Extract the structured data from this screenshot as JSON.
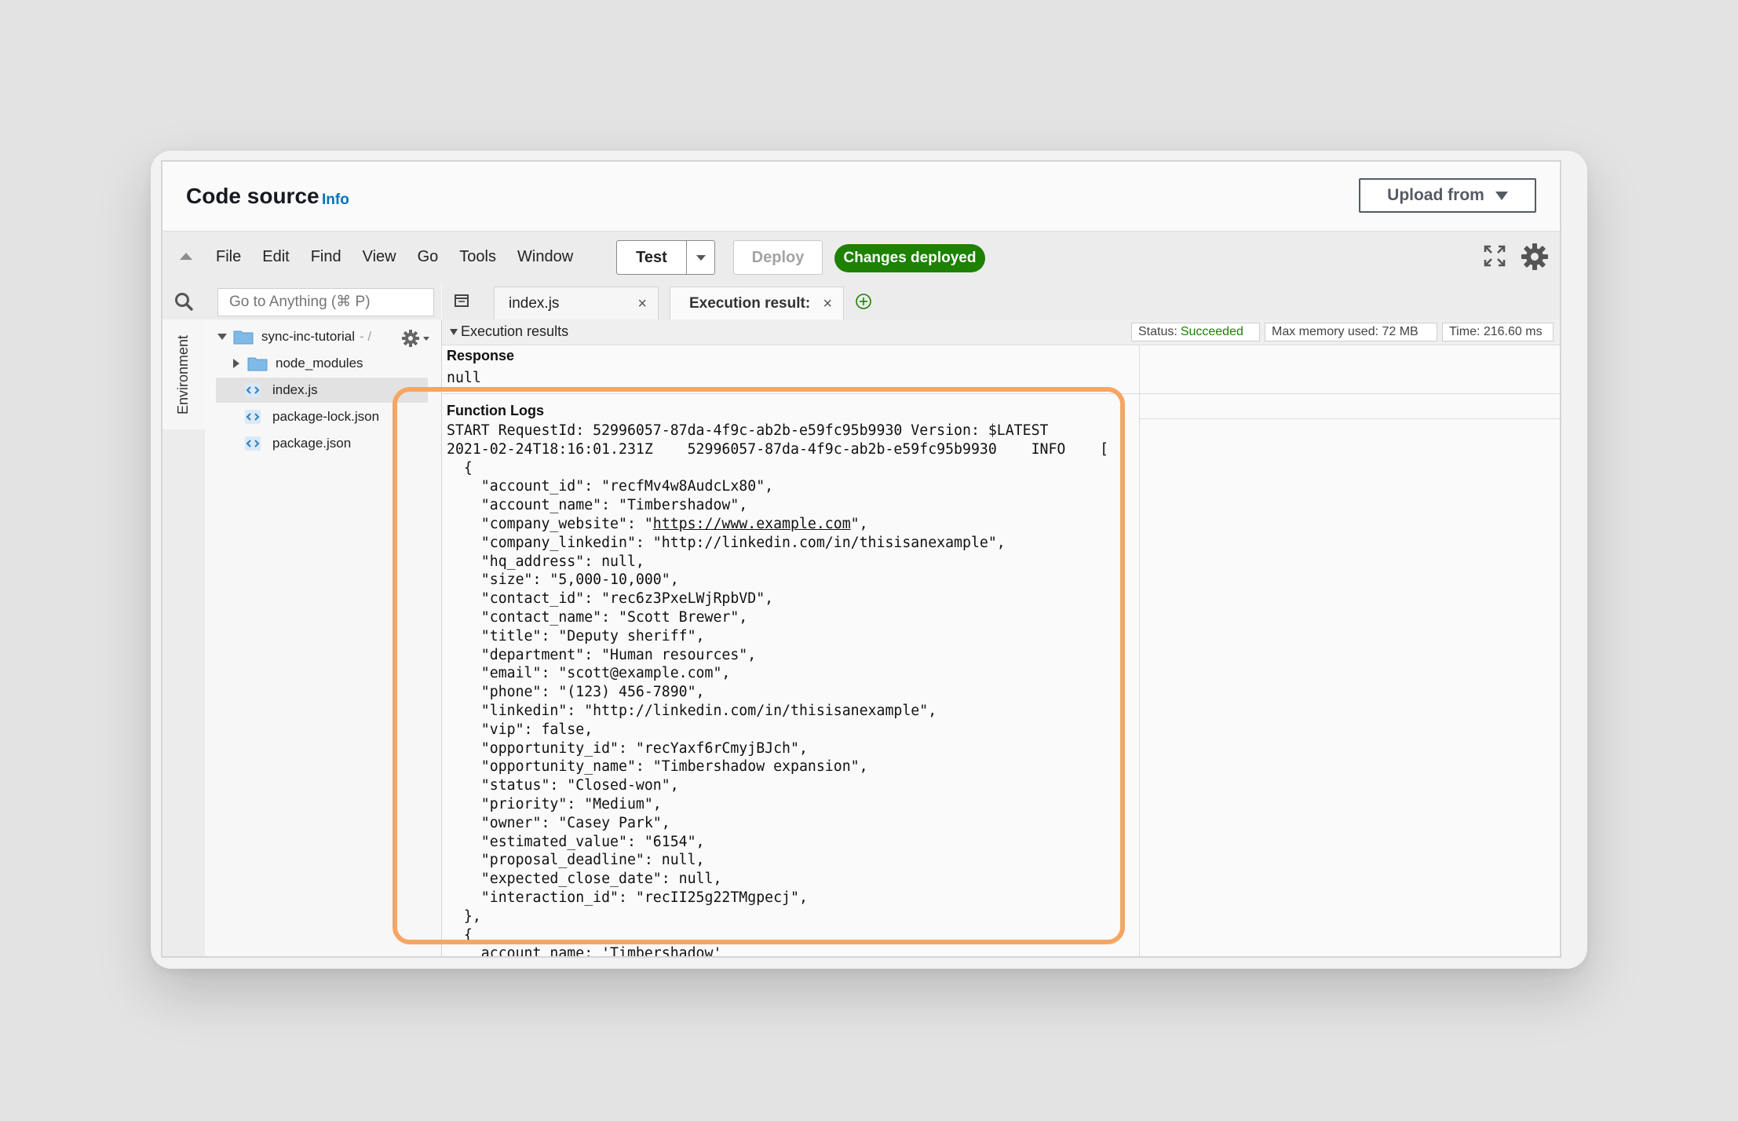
{
  "header": {
    "title": "Code source",
    "info_label": "Info",
    "upload_label": "Upload from"
  },
  "toolbar": {
    "menu": [
      "File",
      "Edit",
      "Find",
      "View",
      "Go",
      "Tools",
      "Window"
    ],
    "test_label": "Test",
    "deploy_label": "Deploy",
    "status_badge": "Changes deployed"
  },
  "sidebar": {
    "search_placeholder": "Go to Anything (⌘ P)",
    "env_label": "Environment",
    "root_folder": "sync-inc-tutorial",
    "root_suffix": "- /",
    "items": [
      {
        "label": "node_modules",
        "type": "folder"
      },
      {
        "label": "index.js",
        "type": "file",
        "selected": true
      },
      {
        "label": "package-lock.json",
        "type": "file"
      },
      {
        "label": "package.json",
        "type": "file"
      }
    ]
  },
  "tabs": [
    {
      "label": "index.js"
    },
    {
      "label": "Execution result:"
    }
  ],
  "results": {
    "heading": "Execution results",
    "status_label": "Status:",
    "status_value": "Succeeded",
    "memory": "Max memory used: 72 MB",
    "time": "Time: 216.60 ms",
    "response_label": "Response",
    "response_value": "null",
    "logs_label": "Function Logs",
    "log_lines": [
      "START RequestId: 52996057-87da-4f9c-ab2b-e59fc95b9930 Version: $LATEST",
      "2021-02-24T18:16:01.231Z    52996057-87da-4f9c-ab2b-e59fc95b9930    INFO    [",
      "  {",
      "    \"account_id\": \"recfMv4w8AudcLx80\",",
      "    \"account_name\": \"Timbershadow\",",
      "    \"company_website\": \"https://www.example.com\",",
      "    \"company_linkedin\": \"http://linkedin.com/in/thisisanexample\",",
      "    \"hq_address\": null,",
      "    \"size\": \"5,000-10,000\",",
      "    \"contact_id\": \"rec6z3PxeLWjRpbVD\",",
      "    \"contact_name\": \"Scott Brewer\",",
      "    \"title\": \"Deputy sheriff\",",
      "    \"department\": \"Human resources\",",
      "    \"email\": \"scott@example.com\",",
      "    \"phone\": \"(123) 456-7890\",",
      "    \"linkedin\": \"http://linkedin.com/in/thisisanexample\",",
      "    \"vip\": false,",
      "    \"opportunity_id\": \"recYaxf6rCmyjBJch\",",
      "    \"opportunity_name\": \"Timbershadow expansion\",",
      "    \"status\": \"Closed-won\",",
      "    \"priority\": \"Medium\",",
      "    \"owner\": \"Casey Park\",",
      "    \"estimated_value\": \"6154\",",
      "    \"proposal_deadline\": null,",
      "    \"expected_close_date\": null,",
      "    \"interaction_id\": \"recII25g22TMgpecj\",",
      "  },",
      "  {",
      "    account_name: 'Timbershadow'"
    ],
    "link_text": "https://www.example.com"
  },
  "colors": {
    "highlight": "#f5a664",
    "success": "#1d8102",
    "info_link": "#0073bb"
  }
}
